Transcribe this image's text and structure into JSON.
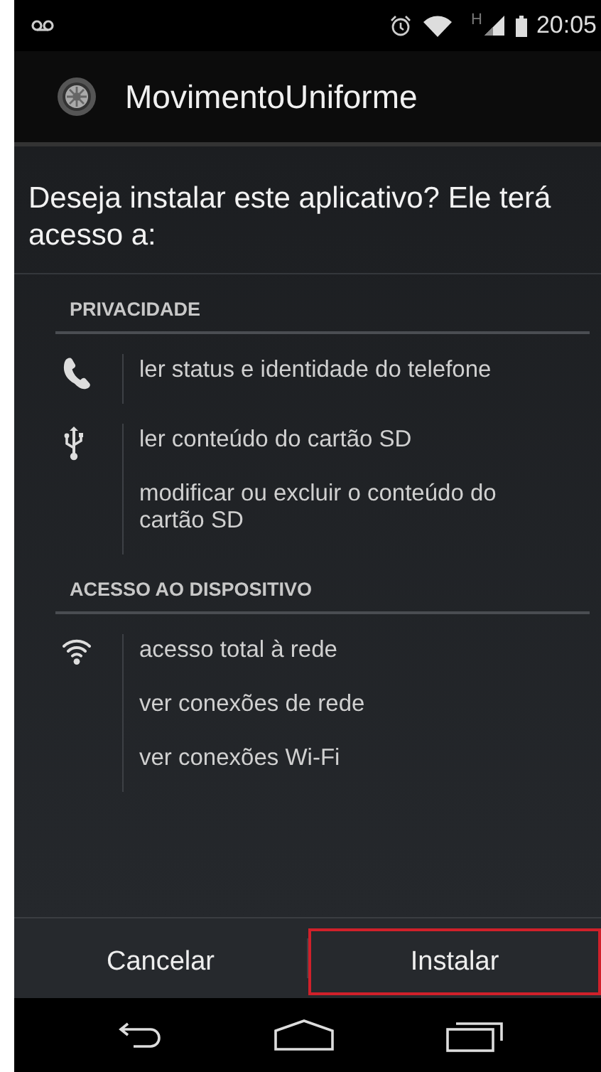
{
  "status_bar": {
    "network": "H",
    "time": "20:05"
  },
  "app": {
    "name": "MovimentoUniforme"
  },
  "prompt": "Deseja instalar este aplicativo? Ele terá acesso a:",
  "sections": [
    {
      "title": "PRIVACIDADE",
      "groups": [
        {
          "kind": "phone",
          "permissions": [
            "ler status e identidade do telefone"
          ]
        },
        {
          "kind": "usb",
          "permissions": [
            "ler conteúdo do cartão SD",
            "modificar ou excluir o conteúdo do cartão SD"
          ]
        }
      ]
    },
    {
      "title": "ACESSO AO DISPOSITIVO",
      "groups": [
        {
          "kind": "wifi",
          "permissions": [
            "acesso total à rede",
            "ver conexões de rede",
            "ver conexões Wi-Fi"
          ]
        }
      ]
    }
  ],
  "buttons": [
    {
      "label": "Cancelar",
      "highlighted": false
    },
    {
      "label": "Instalar",
      "highlighted": true
    }
  ]
}
